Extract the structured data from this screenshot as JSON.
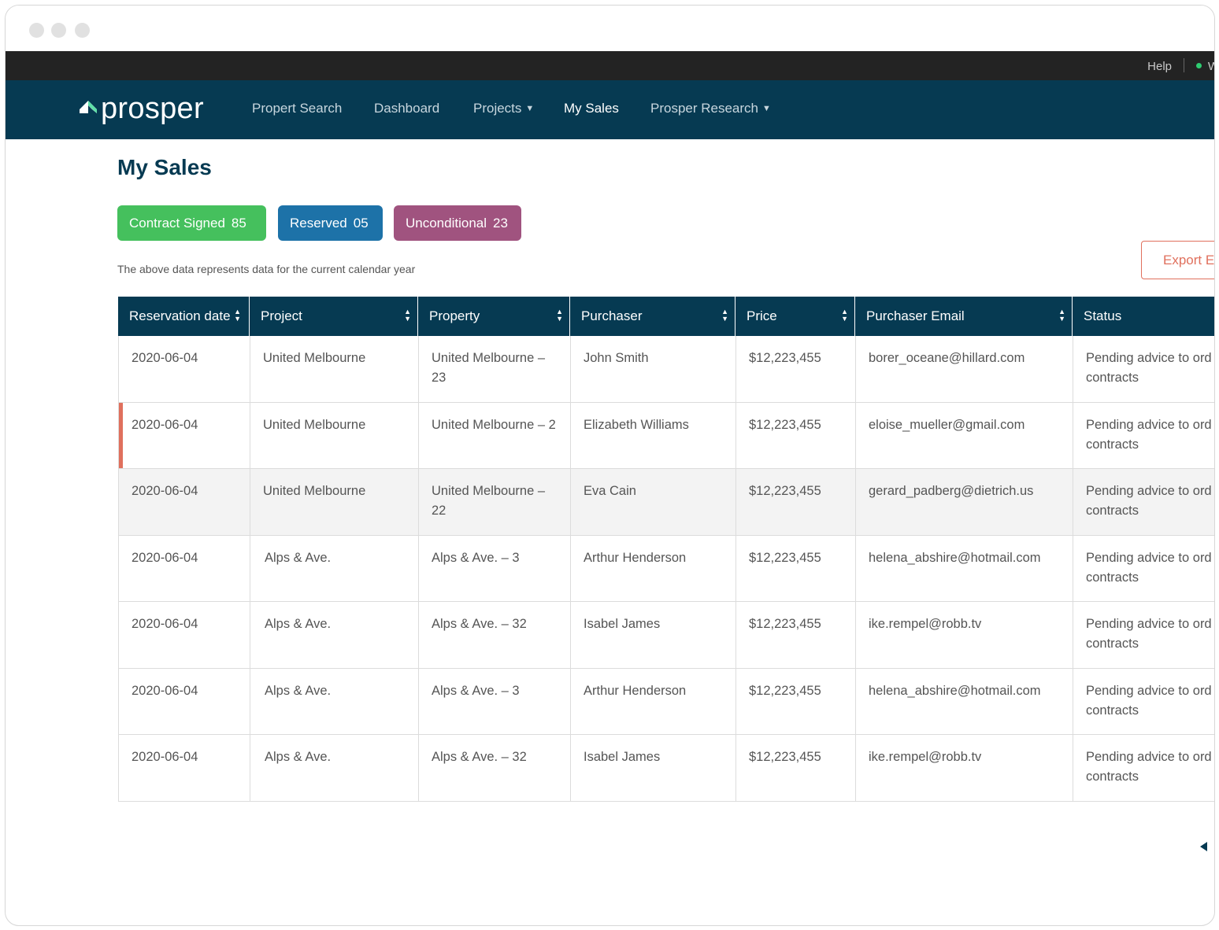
{
  "topbar": {
    "help": "Help",
    "user": "W"
  },
  "brand": {
    "logo_text": "prosper"
  },
  "nav": [
    {
      "label": "Propert Search",
      "has_caret": false,
      "active": false
    },
    {
      "label": "Dashboard",
      "has_caret": false,
      "active": false
    },
    {
      "label": "Projects",
      "has_caret": true,
      "active": false
    },
    {
      "label": "My Sales",
      "has_caret": false,
      "active": true
    },
    {
      "label": "Prosper Research",
      "has_caret": true,
      "active": false
    }
  ],
  "page": {
    "title": "My Sales",
    "note": "The above data represents data for the current calendar year",
    "export_label": "Export E"
  },
  "badges": [
    {
      "label": "Contract Signed",
      "count": "85",
      "color": "#45c05d"
    },
    {
      "label": "Reserved",
      "count": "05",
      "color": "#1d72a8"
    },
    {
      "label": "Unconditional",
      "count": "23",
      "color": "#a0537f"
    }
  ],
  "colors": {
    "navy": "#063a52",
    "accent": "#e0705d",
    "topbar": "#232323"
  },
  "table": {
    "columns": [
      "Reservation date",
      "Project",
      "Property",
      "Purchaser",
      "Price",
      "Purchaser Email",
      "Status"
    ],
    "rows": [
      {
        "date": "2020-06-04",
        "project": "United Melbourne",
        "property": "United Melbourne – 23",
        "purchaser": "John Smith",
        "price": "$12,223,455",
        "email": "borer_oceane@hillard.com",
        "status_1": "Pending advice to ord",
        "status_2": "contracts"
      },
      {
        "date": "2020-06-04",
        "project": "United Melbourne",
        "property": "United Melbourne – 2",
        "purchaser": "Elizabeth Williams",
        "price": "$12,223,455",
        "email": "eloise_mueller@gmail.com",
        "status_1": "Pending advice to ord",
        "status_2": "contracts"
      },
      {
        "date": "2020-06-04",
        "project": "United Melbourne",
        "property": "United Melbourne – 22",
        "purchaser": "Eva Cain",
        "price": "$12,223,455",
        "email": "gerard_padberg@dietrich.us",
        "status_1": "Pending advice to ord",
        "status_2": "contracts"
      },
      {
        "date": "2020-06-04",
        "project": "Alps & Ave.",
        "property": "Alps & Ave. – 3",
        "purchaser": "Arthur Henderson",
        "price": "$12,223,455",
        "email": "helena_abshire@hotmail.com",
        "status_1": "Pending advice to ord",
        "status_2": "contracts"
      },
      {
        "date": "2020-06-04",
        "project": "Alps & Ave.",
        "property": "Alps & Ave. – 32",
        "purchaser": "Isabel James",
        "price": "$12,223,455",
        "email": "ike.rempel@robb.tv",
        "status_1": "Pending advice to ord",
        "status_2": "contracts"
      },
      {
        "date": "2020-06-04",
        "project": "Alps & Ave.",
        "property": "Alps & Ave. – 3",
        "purchaser": "Arthur Henderson",
        "price": "$12,223,455",
        "email": "helena_abshire@hotmail.com",
        "status_1": "Pending advice to ord",
        "status_2": "contracts"
      },
      {
        "date": "2020-06-04",
        "project": "Alps & Ave.",
        "property": "Alps & Ave. – 32",
        "purchaser": "Isabel James",
        "price": "$12,223,455",
        "email": "ike.rempel@robb.tv",
        "status_1": "Pending advice to ord",
        "status_2": "contracts"
      }
    ]
  },
  "icons": {
    "logo": "house-roof-icon",
    "sort": "sort-arrows-icon",
    "caret": "caret-down-icon",
    "pager": "chevron-left-icon",
    "online": "online-status-icon"
  }
}
